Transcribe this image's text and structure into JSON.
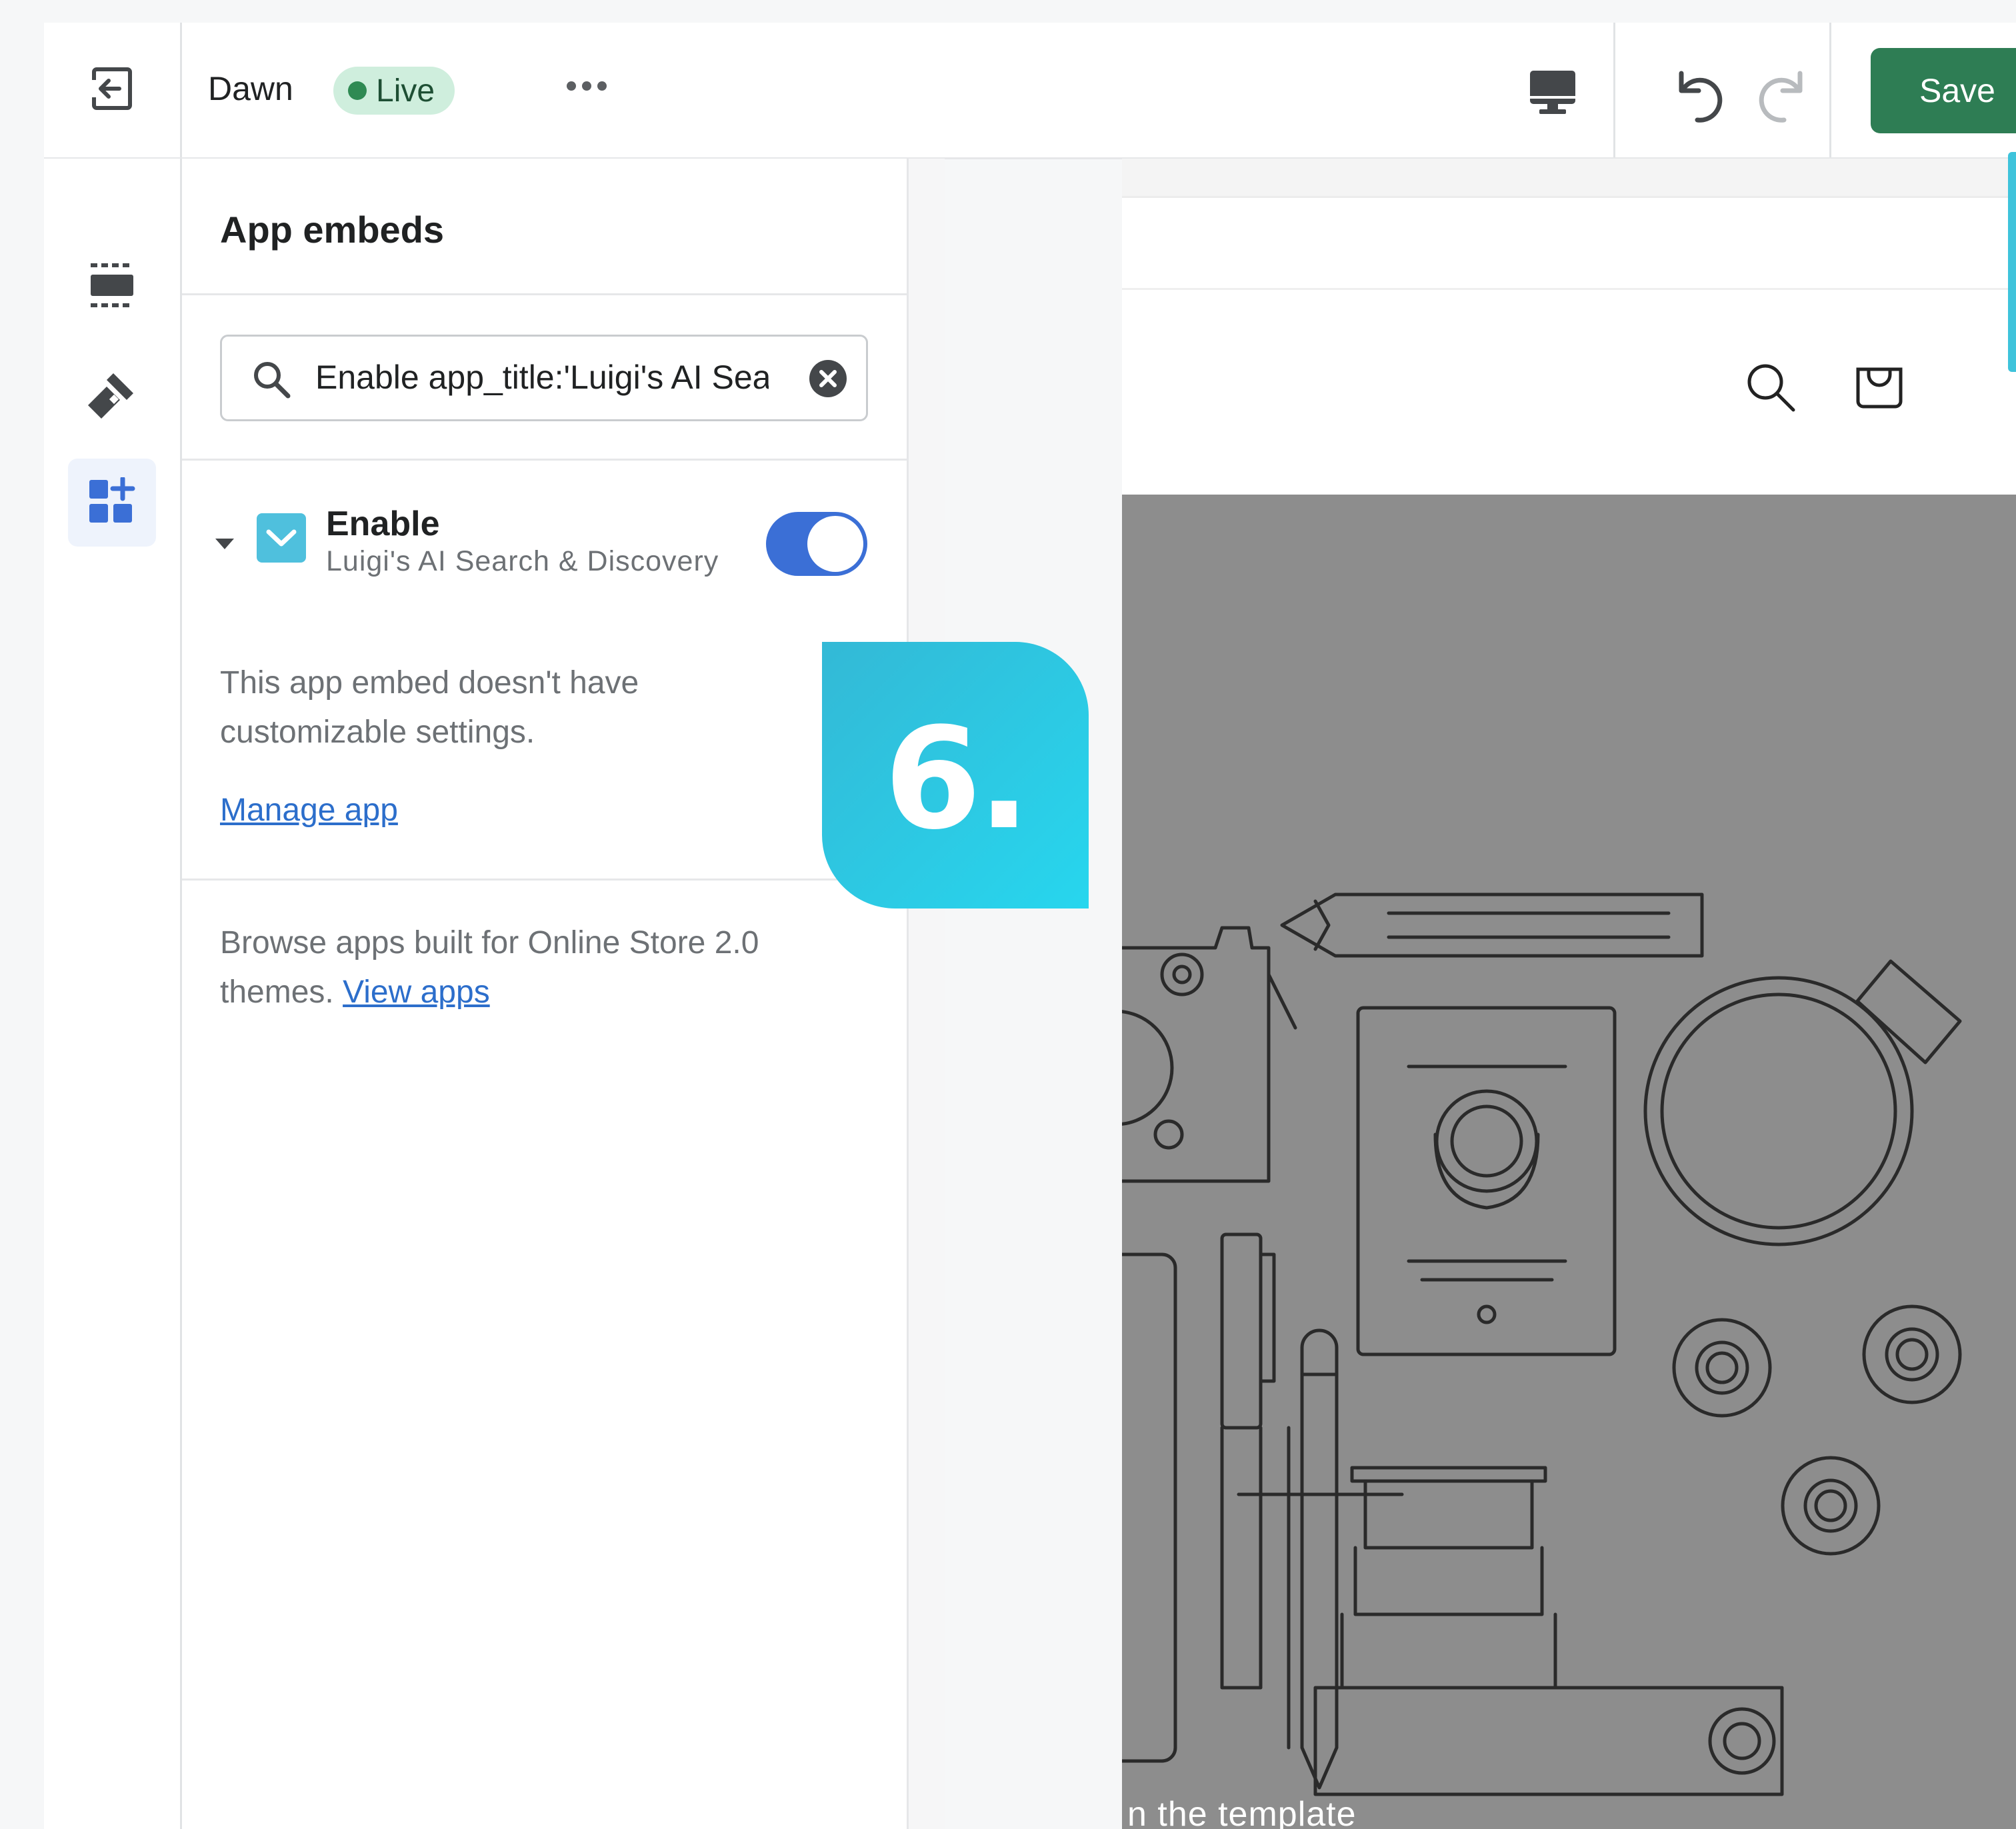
{
  "topbar": {
    "theme_name": "Dawn",
    "status_badge": "Live",
    "save_label": "Save"
  },
  "panel": {
    "title": "App embeds",
    "search": {
      "value": "Enable app_title:'Luigi's AI Search & Discovery'"
    },
    "embed": {
      "name": "Enable",
      "app_name": "Luigi's AI Search & Discovery",
      "enabled": true
    },
    "no_settings_note": "This app embed doesn't have customizable settings.",
    "manage_link": "Manage app",
    "browse_text": "Browse apps built for Online Store 2.0 themes.",
    "view_apps_link": "View apps"
  },
  "preview": {
    "hero_caption": "n the template"
  },
  "step_badge": "6.",
  "colors": {
    "save_green": "#2e7d54",
    "toggle_blue": "#3b6fd6",
    "link_blue": "#2c6ecb",
    "live_badge_bg": "#cfeedd",
    "badge_gradient_start": "#33b9d6",
    "badge_gradient_end": "#27d6ee",
    "hero_gray": "#8d8d8d"
  },
  "icons": {
    "exit": "exit-icon",
    "rail": [
      "sections-icon",
      "theme-settings-icon",
      "app-embeds-icon"
    ],
    "device": "desktop-icon",
    "undo": "undo-icon",
    "redo": "redo-icon",
    "search": "search-icon",
    "clear": "clear-icon",
    "cart": "cart-icon"
  }
}
